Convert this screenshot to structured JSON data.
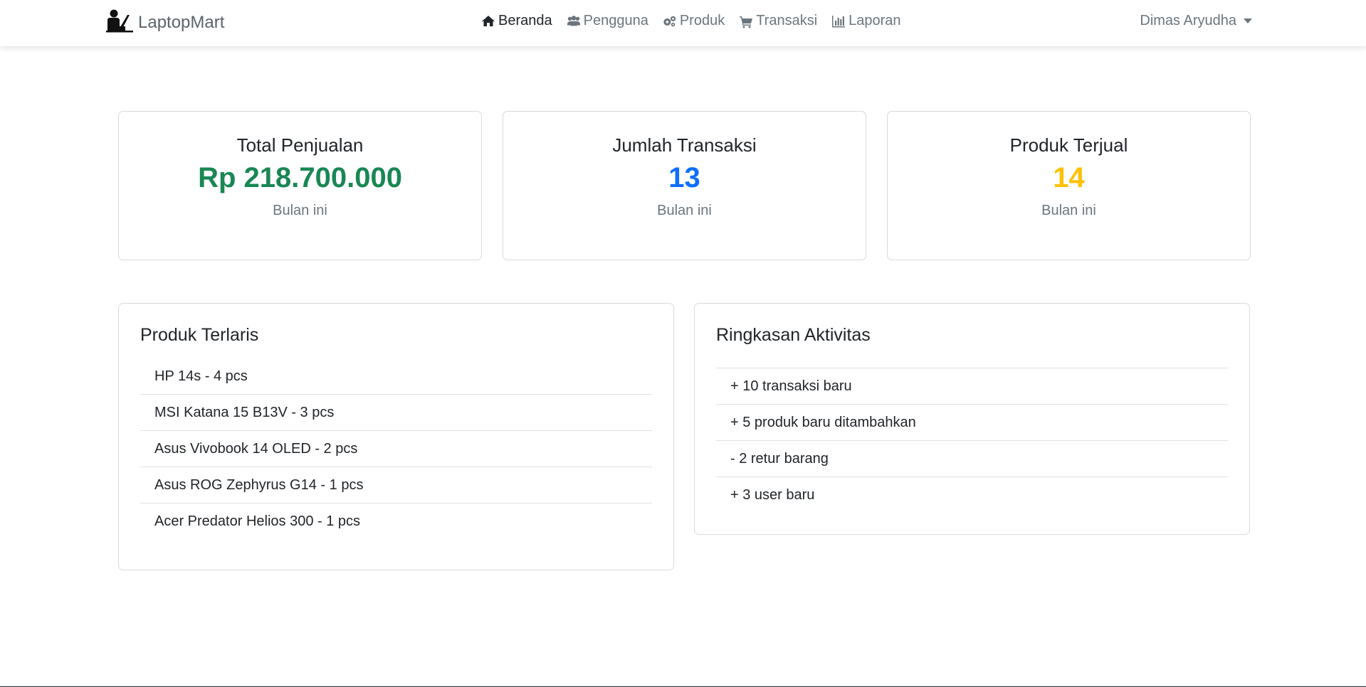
{
  "navbar": {
    "brand": "LaptopMart",
    "brand_icon": "user-laptop-icon",
    "items": [
      {
        "label": "Beranda",
        "icon": "home-icon",
        "active": true
      },
      {
        "label": "Pengguna",
        "icon": "users-icon",
        "active": false
      },
      {
        "label": "Produk",
        "icon": "gears-icon",
        "active": false
      },
      {
        "label": "Transaksi",
        "icon": "cart-icon",
        "active": false
      },
      {
        "label": "Laporan",
        "icon": "bar-chart-icon",
        "active": false
      }
    ],
    "user": "Dimas Aryudha"
  },
  "stats": [
    {
      "title": "Total Penjualan",
      "value": "Rp 218.700.000",
      "sub": "Bulan ini",
      "color": "#198754"
    },
    {
      "title": "Jumlah Transaksi",
      "value": "13",
      "sub": "Bulan ini",
      "color": "#0d6efd"
    },
    {
      "title": "Produk Terjual",
      "value": "14",
      "sub": "Bulan ini",
      "color": "#ffc107"
    }
  ],
  "best_sellers": {
    "title": "Produk Terlaris",
    "items": [
      "HP 14s - 4 pcs",
      "MSI Katana 15 B13V - 3 pcs",
      "Asus Vivobook 14 OLED - 2 pcs",
      "Asus ROG Zephyrus G14 - 1 pcs",
      "Acer Predator Helios 300 - 1 pcs"
    ]
  },
  "activity": {
    "title": "Ringkasan Aktivitas",
    "items": [
      "+ 10 transaksi baru",
      "+ 5 produk baru ditambahkan",
      "- 2 retur barang",
      "+ 3 user baru"
    ]
  }
}
